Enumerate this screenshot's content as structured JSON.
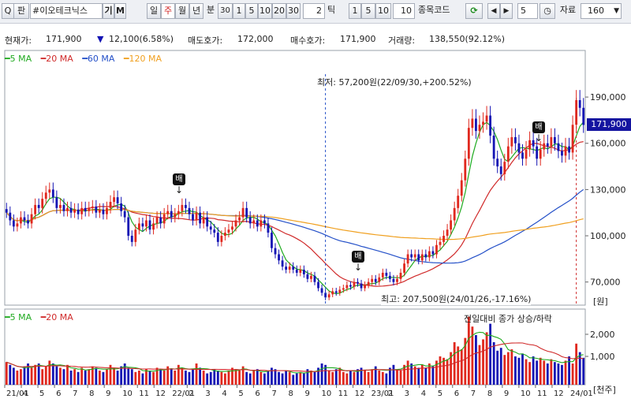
{
  "toolbar": {
    "search_icon_label": "Q",
    "search_label": "판",
    "stock_name": "#이오테크닉스",
    "btn_gi": "기",
    "btn_m": "M",
    "periods": [
      "일",
      "주",
      "월",
      "년",
      "분"
    ],
    "selected_period": "주",
    "minute_buttons": [
      "30",
      "1",
      "5",
      "10",
      "20",
      "30"
    ],
    "tick_value": "2",
    "tick_label": "틱",
    "tick_buttons": [
      "1",
      "5",
      "10"
    ],
    "tick_input": "10",
    "code_label": "종목코드",
    "count_input": "5",
    "data_label": "자료",
    "data_count": "160"
  },
  "info": {
    "price_label": "현재가:",
    "price": "171,900",
    "change": "12,100(6.58%)",
    "ask_label": "매도호가:",
    "ask": "172,000",
    "bid_label": "매수호가:",
    "bid": "171,900",
    "volume_label": "거래량:",
    "volume": "138,550(92.12%)"
  },
  "colors": {
    "up": "#e0281e",
    "down": "#1414b4",
    "ma5": "#1faa1f",
    "ma20": "#d02a2a",
    "ma60": "#2450c8",
    "ma120": "#f0a020"
  },
  "legend_price": [
    {
      "label": "5 MA",
      "color": "#1faa1f"
    },
    {
      "label": "20 MA",
      "color": "#d02a2a"
    },
    {
      "label": "60 MA",
      "color": "#2450c8"
    },
    {
      "label": "120 MA",
      "color": "#f0a020"
    }
  ],
  "legend_volume": [
    {
      "label": "5 MA",
      "color": "#1faa1f"
    },
    {
      "label": "20 MA",
      "color": "#d02a2a"
    }
  ],
  "annotations": {
    "low_text": "최저: 57,200원(22/09/30,+200.52%)",
    "high_text": "최고: 207,500원(24/01/26,-17.16%)",
    "volume_note": "전일대비 종가 상승/하락",
    "signal": "배"
  },
  "chart_data": {
    "type": "candlestick",
    "price_axis": {
      "ticks": [
        "190,000",
        "160,000",
        "130,000",
        "100,000",
        "70,000"
      ],
      "unit": "[원]",
      "current": "171,900"
    },
    "volume_axis": {
      "ticks": [
        "2,000",
        "1,000"
      ],
      "unit": "[천주]"
    },
    "x_ticks": [
      "21/01",
      "4",
      "5",
      "6",
      "7",
      "8",
      "9",
      "10",
      "11",
      "12",
      "22/01",
      "2",
      "3",
      "4",
      "5",
      "6",
      "7",
      "8",
      "9",
      "10",
      "11",
      "12",
      "23/01",
      "2",
      "3",
      "4",
      "5",
      "6",
      "7",
      "8",
      "9",
      "10",
      "11",
      "12",
      "24/01"
    ],
    "close": [
      115000,
      110000,
      106000,
      108000,
      112000,
      110000,
      108000,
      114000,
      120000,
      118000,
      124000,
      128000,
      130000,
      125000,
      118000,
      120000,
      116000,
      118000,
      115000,
      117000,
      114000,
      118000,
      116000,
      118000,
      119000,
      115000,
      117000,
      114000,
      118000,
      122000,
      125000,
      121000,
      116000,
      112000,
      100000,
      96000,
      104000,
      108000,
      106000,
      110000,
      104000,
      108000,
      112000,
      108000,
      114000,
      116000,
      112000,
      114000,
      116000,
      120000,
      118000,
      114000,
      110000,
      115000,
      108000,
      112000,
      106000,
      104000,
      102000,
      96000,
      100000,
      102000,
      104000,
      106000,
      110000,
      112000,
      118000,
      112000,
      108000,
      110000,
      106000,
      110000,
      108000,
      102000,
      92000,
      88000,
      84000,
      80000,
      78000,
      80000,
      78000,
      76000,
      78000,
      75000,
      72000,
      74000,
      70000,
      66000,
      63000,
      60000,
      62000,
      64000,
      63000,
      65000,
      66000,
      68000,
      67000,
      70000,
      69000,
      66000,
      68000,
      70000,
      72000,
      70000,
      73000,
      76000,
      74000,
      72000,
      70000,
      72000,
      76000,
      82000,
      88000,
      86000,
      88000,
      84000,
      88000,
      86000,
      90000,
      88000,
      94000,
      96000,
      100000,
      104000,
      110000,
      118000,
      126000,
      136000,
      150000,
      170000,
      176000,
      168000,
      172000,
      174000,
      178000,
      165000,
      150000,
      145000,
      140000,
      148000,
      158000,
      164000,
      160000,
      154000,
      150000,
      156000,
      162000,
      158000,
      150000,
      156000,
      160000,
      158000,
      164000,
      160000,
      155000,
      152000,
      158000,
      154000,
      172000,
      188000,
      183000,
      171900
    ],
    "volume_pct": [
      32,
      28,
      24,
      20,
      22,
      26,
      30,
      24,
      28,
      30,
      22,
      26,
      34,
      30,
      26,
      24,
      22,
      28,
      20,
      22,
      18,
      24,
      20,
      22,
      26,
      24,
      20,
      18,
      22,
      28,
      24,
      20,
      26,
      30,
      24,
      22,
      18,
      20,
      16,
      22,
      20,
      18,
      24,
      22,
      20,
      26,
      22,
      20,
      28,
      24,
      20,
      18,
      22,
      30,
      24,
      20,
      16,
      18,
      22,
      20,
      18,
      16,
      20,
      24,
      22,
      20,
      26,
      18,
      16,
      20,
      22,
      18,
      16,
      20,
      24,
      22,
      18,
      16,
      20,
      18,
      14,
      16,
      18,
      16,
      22,
      20,
      18,
      24,
      30,
      28,
      20,
      18,
      22,
      24,
      18,
      16,
      20,
      18,
      22,
      24,
      20,
      18,
      22,
      26,
      20,
      18,
      16,
      24,
      28,
      22,
      20,
      28,
      34,
      30,
      26,
      24,
      28,
      24,
      30,
      26,
      34,
      40,
      38,
      36,
      46,
      60,
      54,
      50,
      66,
      96,
      82,
      70,
      56,
      64,
      74,
      86,
      60,
      48,
      52,
      42,
      46,
      50,
      40,
      38,
      44,
      36,
      32,
      40,
      34,
      38,
      34,
      30,
      36,
      32,
      30,
      28,
      34,
      40,
      30,
      58,
      46,
      38
    ],
    "volume_up": [
      true,
      false,
      false,
      true,
      true,
      false,
      false,
      true,
      true,
      false,
      true,
      true,
      true,
      false,
      false,
      true,
      false,
      true,
      false,
      true,
      false,
      true,
      false,
      true,
      true,
      false,
      true,
      false,
      true,
      true,
      true,
      false,
      false,
      false,
      false,
      false,
      true,
      true,
      false,
      true,
      false,
      true,
      true,
      false,
      true,
      true,
      false,
      true,
      true,
      true,
      false,
      false,
      false,
      true,
      false,
      true,
      false,
      false,
      false,
      false,
      true,
      true,
      true,
      true,
      true,
      true,
      true,
      false,
      false,
      true,
      false,
      true,
      false,
      false,
      false,
      false,
      false,
      false,
      false,
      true,
      false,
      false,
      true,
      false,
      false,
      true,
      false,
      false,
      false,
      false,
      true,
      true,
      false,
      true,
      true,
      true,
      false,
      true,
      false,
      false,
      true,
      true,
      true,
      false,
      true,
      true,
      false,
      false,
      false,
      true,
      true,
      true,
      true,
      false,
      true,
      false,
      true,
      false,
      true,
      false,
      true,
      true,
      true,
      true,
      true,
      true,
      true,
      true,
      true,
      true,
      true,
      false,
      true,
      true,
      true,
      false,
      false,
      false,
      false,
      true,
      true,
      true,
      false,
      false,
      false,
      true,
      true,
      false,
      false,
      true,
      true,
      false,
      true,
      false,
      false,
      false,
      true,
      false,
      true,
      true,
      false,
      false
    ]
  }
}
